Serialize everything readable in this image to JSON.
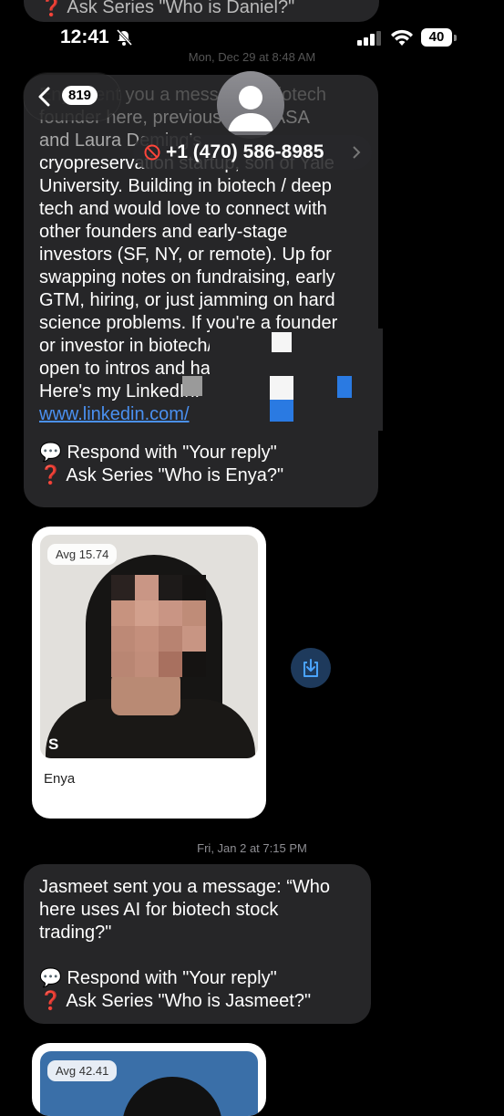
{
  "prev_bubble": {
    "line": "❓ Ask Series \"Who is Daniel?\""
  },
  "status_bar": {
    "time": "12:41",
    "battery": "40"
  },
  "nav": {
    "back_count": "819",
    "phone": "+1 (470) 586-8985"
  },
  "stamps": {
    "first": "Mon, Dec 29 at 8:48 AM",
    "second": "Fri, Jan 2 at 7:15 PM"
  },
  "message1": {
    "line1": "Enya sent you a message: \"Biotech",
    "line2": "founder here, previously at NASA",
    "line3": "and Laura Deming's",
    "line4": "cryopreservation startup, son of Yale",
    "line5": "University. Building in biotech / deep",
    "line6": "tech and would love to connect with",
    "line7": "other founders and early-stage",
    "line8": "investors (SF, NY, or remote). Up for",
    "line9": "swapping notes on fundraising, early",
    "line10": "GTM, hiring, or just jamming on hard",
    "line11": "science problems. If you're a founder",
    "line12": "or investor in biotech/frontier tech,",
    "line13": "open to intros and happy to help.",
    "line14": "Here's my LinkedIn:",
    "link": "www.linkedin.com/",
    "respond": "💬 Respond with \"Your reply\"",
    "ask": "❓ Ask Series \"Who is Enya?\""
  },
  "card1": {
    "avg": "Avg 15.74",
    "initial": "S",
    "name": "Enya"
  },
  "message2": {
    "line1": "Jasmeet sent you a message: “Who",
    "line2": "here uses AI for biotech stock",
    "line3": "trading?\"",
    "respond": "💬 Respond with \"Your reply\"",
    "ask": "❓ Ask Series \"Who is Jasmeet?\""
  },
  "card2": {
    "avg": "Avg 42.41"
  },
  "colors": {
    "bubble": "#262628",
    "link": "#4a90f0",
    "save_button": "#1e3a5c"
  }
}
